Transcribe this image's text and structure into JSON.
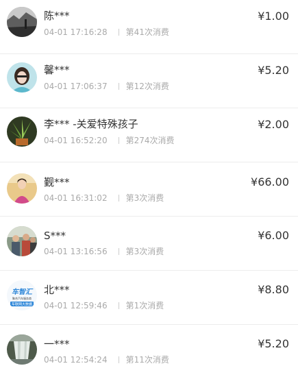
{
  "records": [
    {
      "name": "陈***",
      "time": "04-01 17:16:28",
      "count": "第41次消费",
      "amount": "¥1.00",
      "avatar_icon": "landscape-photo-avatar"
    },
    {
      "name": "馨***",
      "time": "04-01 17:06:37",
      "count": "第12次消费",
      "amount": "¥5.20",
      "avatar_icon": "girl-photo-avatar"
    },
    {
      "name": "李*** -关爱特殊孩子",
      "time": "04-01 16:52:20",
      "count": "第274次消费",
      "amount": "¥2.00",
      "avatar_icon": "plant-photo-avatar"
    },
    {
      "name": "觐***",
      "time": "04-01 16:31:02",
      "count": "第3次消费",
      "amount": "¥66.00",
      "avatar_icon": "person-photo-avatar"
    },
    {
      "name": "S***",
      "time": "04-01 13:16:56",
      "count": "第3次消费",
      "amount": "¥6.00",
      "avatar_icon": "group-photo-avatar"
    },
    {
      "name": "北***",
      "time": "04-01 12:59:46",
      "count": "第1次消费",
      "amount": "¥8.80",
      "avatar_icon": "logo-avatar",
      "avatar_logo_text": [
        "车智汇",
        "聚合汽车服务商",
        "车联网大数据"
      ]
    },
    {
      "name": "一***",
      "time": "04-01 12:54:24",
      "count": "第11次消费",
      "amount": "¥5.20",
      "avatar_icon": "waterfall-photo-avatar"
    }
  ]
}
